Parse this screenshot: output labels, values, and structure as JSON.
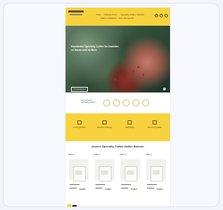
{
  "header": {
    "logo_text": "STRONGHOLD",
    "nav": [
      "Shop",
      "Kaffeebohnen",
      "Specialty Coffee",
      "Zubehör",
      "Kaffee entdecken",
      "Über Stronghold"
    ]
  },
  "hero": {
    "title": "Exzellenter Specialty Coffee für Genießer zu Hause und im Büro",
    "button": "Jetzt entdecken"
  },
  "badges": {
    "text": "Fair gehandelt, nachhaltig geröstet"
  },
  "features": [
    {
      "icon": "cup-icon",
      "title": "Frisch geröstet"
    },
    {
      "icon": "truck-icon",
      "title": "Schnelle Lieferung"
    },
    {
      "icon": "leaf-icon",
      "title": "Nachhaltig"
    },
    {
      "icon": "star-icon",
      "title": "Premium Qualität"
    }
  ],
  "section": {
    "title": "Unsere Specialty Coffee Kaffee Bohnen"
  },
  "products": [
    {
      "name": "Kaffee 1",
      "price": "12,90 €"
    },
    {
      "name": "Kaffee 2",
      "price": "14,90 €"
    },
    {
      "name": "Kaffee 3",
      "price": "11,90 €"
    },
    {
      "name": "Kaffee 4",
      "price": "15,90 €"
    }
  ]
}
